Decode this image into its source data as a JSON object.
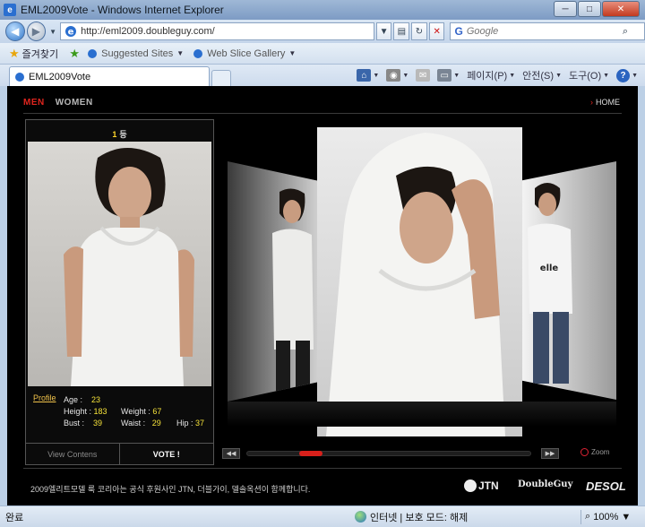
{
  "window": {
    "title": "EML2009Vote - Windows Internet Explorer",
    "min": "─",
    "max": "□",
    "close": "✕"
  },
  "address": {
    "url": "http://eml2009.doubleguy.com/",
    "search_placeholder": "Google"
  },
  "favorites": {
    "label": "즐겨찾기",
    "items": [
      {
        "label": "Suggested Sites"
      },
      {
        "label": "Web Slice Gallery"
      }
    ]
  },
  "tab": {
    "label": "EML2009Vote"
  },
  "commandbar": {
    "page": "페이지(P)",
    "safety": "안전(S)",
    "tools": "도구(O)",
    "help": "?"
  },
  "site": {
    "nav_men": "MEN",
    "nav_women": "WOMEN",
    "home": "HOME",
    "rank_number": "1",
    "rank_suffix": "등",
    "profile_link": "Profile",
    "age_label": "Age :",
    "age": "23",
    "height_label": "Height :",
    "height": "183",
    "weight_label": "Weight :",
    "weight": "67",
    "bust_label": "Bust :",
    "bust": "39",
    "waist_label": "Waist :",
    "waist": "29",
    "hip_label": "Hip :",
    "hip": "37",
    "view_contents": "View Contens",
    "vote": "VOTE !",
    "zoom": "Zoom",
    "slider_progress": 0.2,
    "footer_text": "2009엘리트모델 룩 코리아는 공식 후원사인 JTN, 더블가이, 델솔옥션이 함께합니다.",
    "sponsor_1": "JTN",
    "sponsor_2": "DoubleGuy",
    "sponsor_3": "DESOL",
    "accent_color": "#e0251e",
    "value_color": "#f5e23a"
  },
  "status": {
    "done": "완료",
    "zone": "인터넷 | 보호 모드: 해제",
    "zoom": "100%"
  }
}
